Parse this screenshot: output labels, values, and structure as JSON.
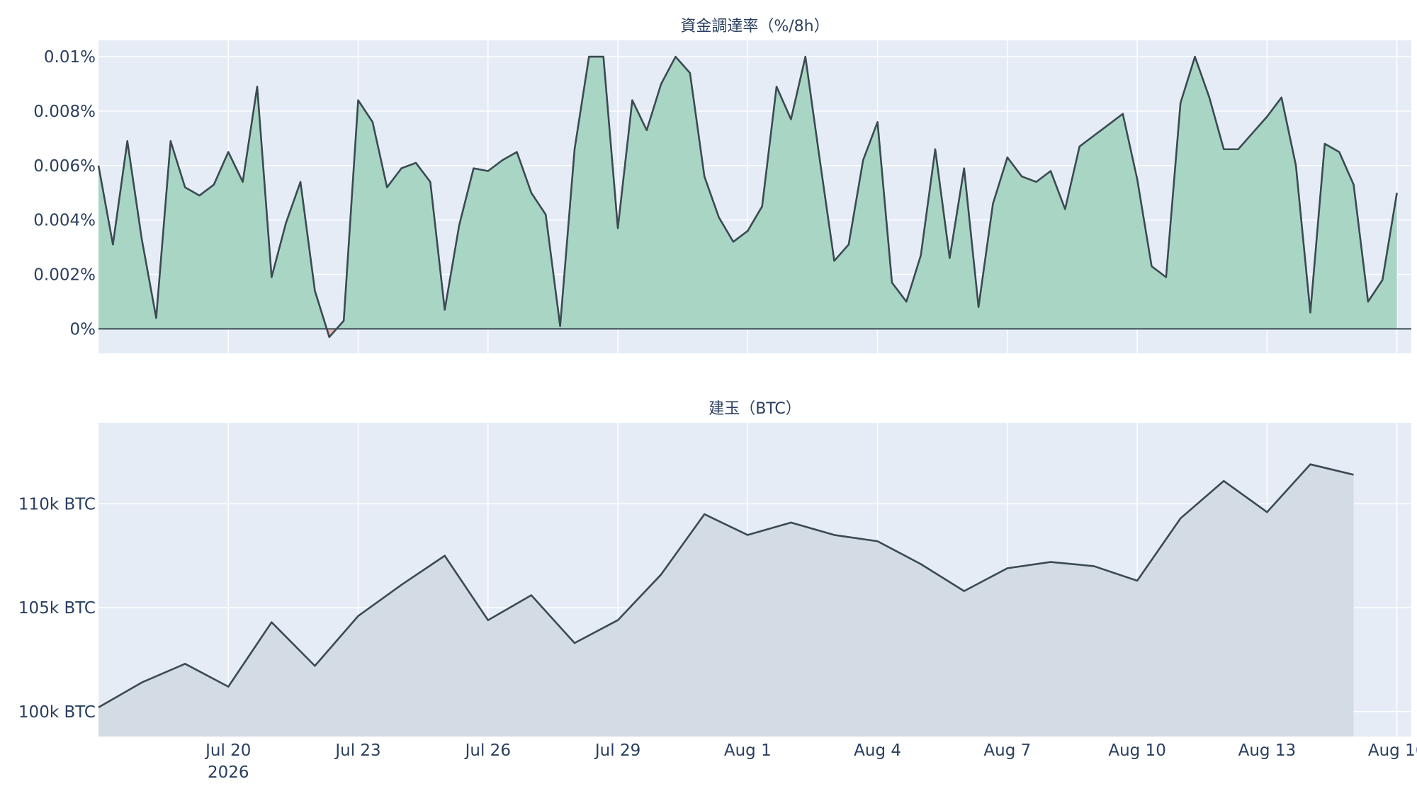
{
  "chart_data": [
    {
      "type": "area",
      "title": "資金調達率（%/8h）",
      "xlabel": "",
      "ylabel": "",
      "unit": "%",
      "x_start": "2026-07-17",
      "x_step_hours": 8,
      "xlim": [
        "2026-07-17",
        "2026-08-16 08:00"
      ],
      "ylim": [
        -0.0009,
        0.0106
      ],
      "y_ticks": [
        0,
        0.002,
        0.004,
        0.006,
        0.008,
        0.01
      ],
      "y_tick_labels": [
        "0%",
        "0.002%",
        "0.004%",
        "0.006%",
        "0.008%",
        "0.01%"
      ],
      "grid": true,
      "colors": {
        "line": "#3b4a52",
        "positive_fill": "#a9d6c4",
        "negative_fill": "#f2b8b5",
        "plot_bg": "#e5ecf6",
        "grid": "#ffffff",
        "zero_line": "#3b4a52"
      },
      "values": [
        0.006,
        0.0031,
        0.0069,
        0.0033,
        0.0004,
        0.0069,
        0.0052,
        0.0049,
        0.0053,
        0.0065,
        0.0054,
        0.0089,
        0.0019,
        0.0039,
        0.0054,
        0.0014,
        -0.0003,
        0.0003,
        0.0084,
        0.0076,
        0.0052,
        0.0059,
        0.0061,
        0.0054,
        0.0007,
        0.0038,
        0.0059,
        0.0058,
        0.0062,
        0.0065,
        0.005,
        0.0042,
        0.0001,
        0.0066,
        0.01,
        0.01,
        0.0037,
        0.0084,
        0.0073,
        0.009,
        0.01,
        0.0094,
        0.0056,
        0.0041,
        0.0032,
        0.0036,
        0.0045,
        0.0089,
        0.0077,
        0.01,
        0.0062,
        0.0025,
        0.0031,
        0.0062,
        0.0076,
        0.0017,
        0.001,
        0.0027,
        0.0066,
        0.0026,
        0.0059,
        0.0008,
        0.0046,
        0.0063,
        0.0056,
        0.0054,
        0.0058,
        0.0044,
        0.0067,
        0.0071,
        0.0075,
        0.0079,
        0.0055,
        0.0023,
        0.0019,
        0.0083,
        0.01,
        0.0085,
        0.0066,
        0.0066,
        0.0072,
        0.0078,
        0.0085,
        0.006,
        0.0006,
        0.0068,
        0.0065,
        0.0053,
        0.001,
        0.0018,
        0.005
      ]
    },
    {
      "type": "area",
      "title": "建玉（BTC）",
      "xlabel": "",
      "ylabel": "",
      "unit": "BTC",
      "xlim": [
        "2026-07-17",
        "2026-08-16 08:00"
      ],
      "ylim": [
        98800,
        113900
      ],
      "y_ticks": [
        100000,
        105000,
        110000
      ],
      "y_tick_labels": [
        "100k BTC",
        "105k BTC",
        "110k BTC"
      ],
      "x_tick_labels": [
        "Jul 20",
        "Jul 23",
        "Jul 26",
        "Jul 29",
        "Aug 1",
        "Aug 4",
        "Aug 7",
        "Aug 10",
        "Aug 13",
        "Aug 16"
      ],
      "x_tick_dates": [
        "2026-07-20",
        "2026-07-23",
        "2026-07-26",
        "2026-07-29",
        "2026-08-01",
        "2026-08-04",
        "2026-08-07",
        "2026-08-10",
        "2026-08-13",
        "2026-08-16"
      ],
      "x_year_label": "2026",
      "grid": true,
      "colors": {
        "line": "#3b4a52",
        "fill": "#d3dbe5",
        "plot_bg": "#e5ecf6",
        "grid": "#ffffff"
      },
      "x": [
        "2026-07-17",
        "2026-07-18",
        "2026-07-19",
        "2026-07-20",
        "2026-07-21",
        "2026-07-22",
        "2026-07-23",
        "2026-07-24",
        "2026-07-25",
        "2026-07-26",
        "2026-07-27",
        "2026-07-28",
        "2026-07-29",
        "2026-07-30",
        "2026-07-31",
        "2026-08-01",
        "2026-08-02",
        "2026-08-03",
        "2026-08-04",
        "2026-08-05",
        "2026-08-06",
        "2026-08-07",
        "2026-08-08",
        "2026-08-09",
        "2026-08-10",
        "2026-08-11",
        "2026-08-12",
        "2026-08-13",
        "2026-08-14",
        "2026-08-15",
        "2026-08-16"
      ],
      "values": [
        100200,
        101400,
        102300,
        101200,
        104300,
        102200,
        104600,
        106100,
        107500,
        104400,
        105600,
        103300,
        104400,
        106600,
        109500,
        108500,
        109100,
        108500,
        108200,
        107100,
        105800,
        106900,
        107200,
        107000,
        106300,
        109300,
        111100,
        109600,
        111900,
        111400
      ]
    }
  ]
}
